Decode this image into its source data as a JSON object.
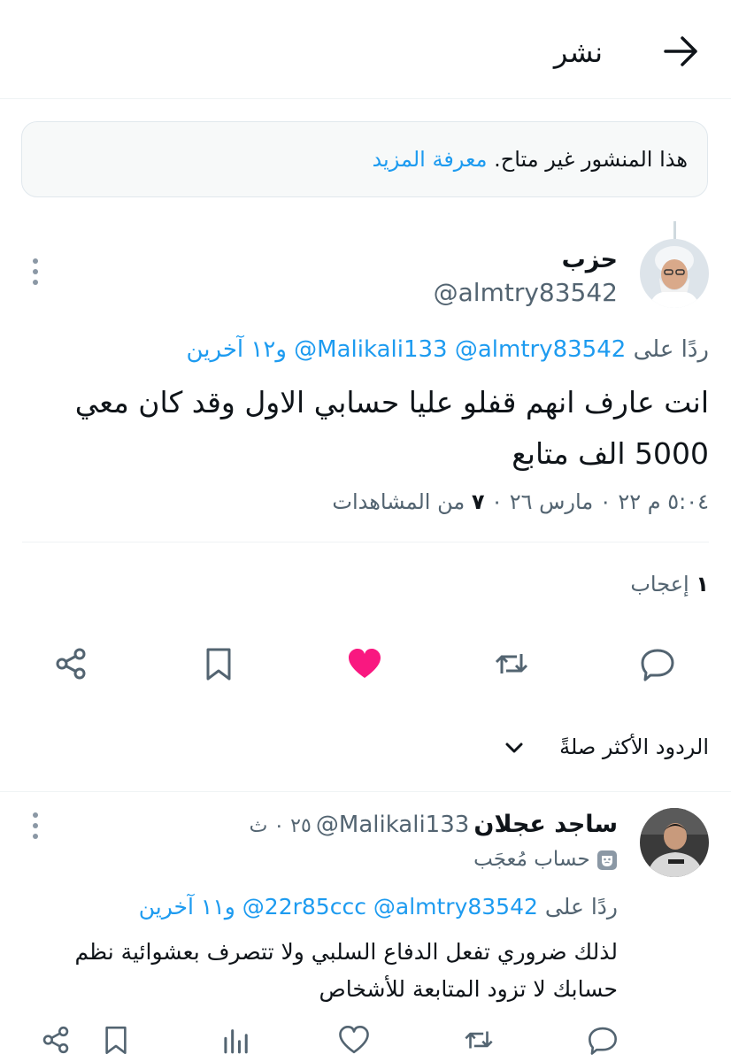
{
  "header": {
    "title": "نشر"
  },
  "notice": {
    "text": "هذا المنشور غير متاح.",
    "link": "معرفة المزيد"
  },
  "post": {
    "display_name": "حزب",
    "handle": "@almtry83542",
    "reply_prefix": "ردًا على",
    "reply_mentions": "@Malikali133 @almtry83542",
    "reply_suffix": "و١٢ آخرين",
    "text_line1": "انت عارف انهم قفلو عليا حسابي الاول وقد كان معي",
    "text_line2": "5000 الف متابع",
    "timestamp": "٥:٠٤ م ٢٢ ٠ مارس ٢٦ ٠",
    "views_count": "٧",
    "views_label": "من المشاهدات",
    "likes_count": "١",
    "likes_label": "إعجاب",
    "liked": true
  },
  "replies_sort": {
    "label": "الردود الأكثر صلةً"
  },
  "reply": {
    "display_name": "ساجد عجلان",
    "handle": "@Malikali133",
    "time": "٢٥ ٠ ث",
    "account_badge": "حساب مُعجَب",
    "reply_prefix": "ردًا على",
    "reply_mentions": "@22r85ccc @almtry83542",
    "reply_suffix": "و١١ آخرين",
    "text_line1": "لذلك ضروري تفعل الدفاع السلبي ولا تتصرف بعشوائية نظم",
    "text_line2": "حسابك لا تزود المتابعة للأشخاص"
  },
  "colors": {
    "accent": "#1d9bf0",
    "like": "#f91880",
    "muted": "#536471"
  },
  "icons": [
    "arrow-right-icon",
    "more-icon",
    "share-icon",
    "bookmark-icon",
    "heart-icon",
    "retweet-icon",
    "reply-icon",
    "chevron-down-icon",
    "mask-icon",
    "analytics-icon"
  ]
}
